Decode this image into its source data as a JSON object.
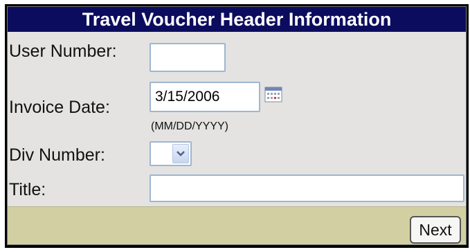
{
  "header": {
    "title": "Travel Voucher Header Information"
  },
  "form": {
    "user_number_label": "User Number:",
    "user_number_value": "",
    "invoice_date_label": "Invoice Date:",
    "invoice_date_value": "3/15/2006",
    "invoice_date_hint": "(MM/DD/YYYY)",
    "div_number_label": "Div Number:",
    "div_number_value": "",
    "title_label": "Title:",
    "title_value": ""
  },
  "footer": {
    "next_label": "Next"
  },
  "icons": {
    "calendar": "calendar-icon",
    "dropdown": "chevron-down-icon"
  },
  "colors": {
    "header_bg": "#0c0c5e",
    "panel_bg": "#e4e3e1",
    "footer_bg": "#d2cfa3",
    "field_border": "#9eb6d0"
  }
}
